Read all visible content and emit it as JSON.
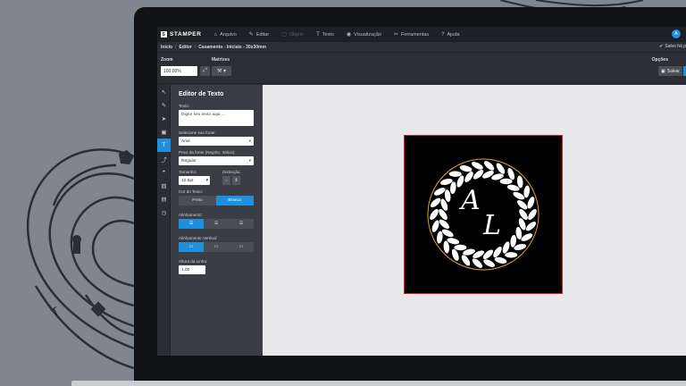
{
  "app": {
    "brand": "STAMPER",
    "brand_letter": "S"
  },
  "menu": [
    {
      "icon": "⌂",
      "label": "Arquivo",
      "disabled": false
    },
    {
      "icon": "✎",
      "label": "Editar",
      "disabled": false
    },
    {
      "icon": "▢",
      "label": "Objeto",
      "disabled": true
    },
    {
      "icon": "T",
      "label": "Texto",
      "disabled": false
    },
    {
      "icon": "◉",
      "label": "Visualização",
      "disabled": false
    },
    {
      "icon": "✂",
      "label": "Ferramentas",
      "disabled": false
    },
    {
      "icon": "?",
      "label": "Ajuda",
      "disabled": false
    }
  ],
  "user": {
    "initial": "A"
  },
  "breadcrumb": [
    "Início",
    "Editor",
    "Casamento - Iniciais - 30x30mm"
  ],
  "status": {
    "saved": "Salvo há p"
  },
  "toolbar": {
    "zoom_label": "Zoom",
    "zoom_value": "100.00%",
    "matrices_label": "Matrizes",
    "options_label": "Opções",
    "save_label": "Salvar"
  },
  "rail": [
    {
      "icon": "↖",
      "name": "select-tool-icon"
    },
    {
      "icon": "✎",
      "name": "pen-tool-icon"
    },
    {
      "icon": "➤",
      "name": "node-tool-icon"
    },
    {
      "icon": "▣",
      "name": "shape-tool-icon"
    },
    {
      "icon": "T",
      "name": "text-tool-icon",
      "active": true
    },
    {
      "icon": "⤴",
      "name": "transform-tool-icon"
    },
    {
      "icon": "◓",
      "name": "fill-tool-icon"
    },
    {
      "icon": "▨",
      "name": "image-tool-icon"
    },
    {
      "icon": "▤",
      "name": "layers-tool-icon"
    },
    {
      "icon": "◷",
      "name": "history-tool-icon"
    }
  ],
  "panel": {
    "title": "Editor de Texto",
    "text_label": "Texto:",
    "text_placeholder": "Digite seu texto aqui ...",
    "font_label": "Selecione sua fonte:",
    "font_value": "Arial",
    "weight_label": "Peso da fonte (Negrito, Itálico):",
    "weight_value": "Regular",
    "size_label": "Tamanho:",
    "size_value": "10.5pt",
    "distortion_label": "Distorção:",
    "color_label": "Cor do Texto:",
    "color_options": [
      "Preto",
      "Branco"
    ],
    "color_selected": 1,
    "align_label": "Alinhamento:",
    "valign_label": "Alinhamento Vertical:",
    "lineheight_label": "Altura da Linha:",
    "lineheight_value": "1.00"
  },
  "colors": {
    "accent": "#1e90e0",
    "artboard_border": "#e11b22",
    "ring": "#d4a52b"
  },
  "artwork": {
    "monogram_top": "A",
    "monogram_bottom": "L"
  }
}
